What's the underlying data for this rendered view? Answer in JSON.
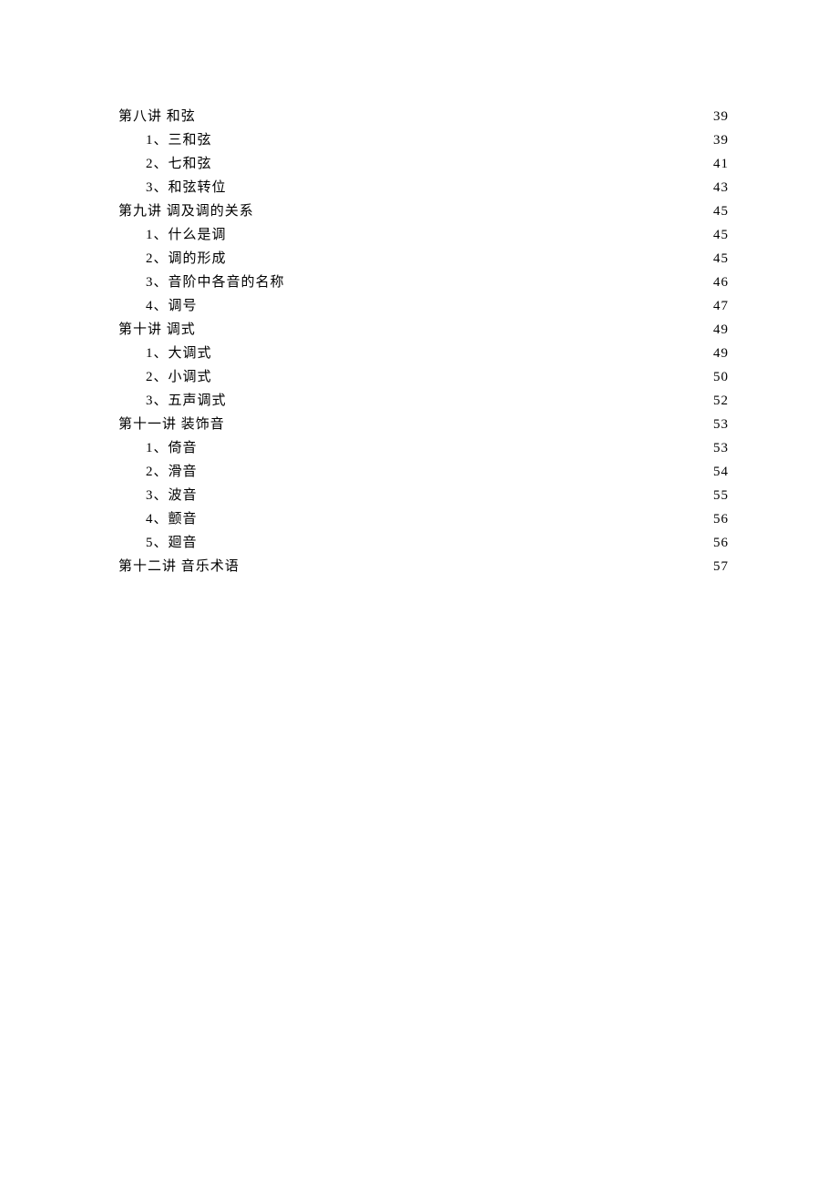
{
  "toc": [
    {
      "level": 1,
      "label": "第八讲 和弦",
      "page": "39"
    },
    {
      "level": 2,
      "label": "1、三和弦",
      "page": "39"
    },
    {
      "level": 2,
      "label": "2、七和弦",
      "page": "41"
    },
    {
      "level": 2,
      "label": "3、和弦转位",
      "page": "43"
    },
    {
      "level": 1,
      "label": "第九讲 调及调的关系",
      "page": "45"
    },
    {
      "level": 2,
      "label": "1、什么是调",
      "page": "45"
    },
    {
      "level": 2,
      "label": "2、调的形成",
      "page": "45"
    },
    {
      "level": 2,
      "label": "3、音阶中各音的名称",
      "page": "46"
    },
    {
      "level": 2,
      "label": "4、调号",
      "page": "47"
    },
    {
      "level": 1,
      "label": "第十讲 调式",
      "page": "49"
    },
    {
      "level": 2,
      "label": "1、大调式",
      "page": "49"
    },
    {
      "level": 2,
      "label": "2、小调式",
      "page": "50"
    },
    {
      "level": 2,
      "label": "3、五声调式",
      "page": "52"
    },
    {
      "level": 1,
      "label": "第十一讲 装饰音",
      "page": "53"
    },
    {
      "level": 2,
      "label": "1、倚音",
      "page": "53"
    },
    {
      "level": 2,
      "label": "2、滑音",
      "page": "54"
    },
    {
      "level": 2,
      "label": "3、波音",
      "page": "55"
    },
    {
      "level": 2,
      "label": "4、颤音",
      "page": "56"
    },
    {
      "level": 2,
      "label": "5、廻音",
      "page": "56"
    },
    {
      "level": 1,
      "label": "第十二讲 音乐术语",
      "page": "57"
    }
  ]
}
